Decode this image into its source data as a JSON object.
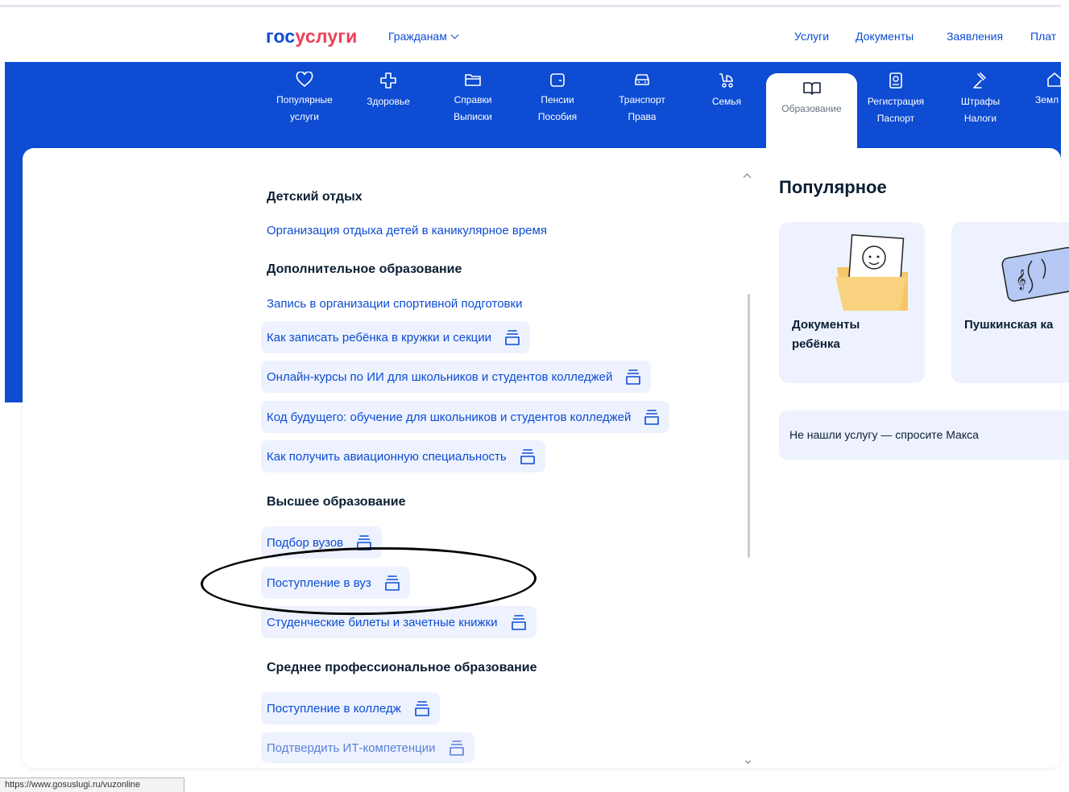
{
  "header": {
    "logo_part1": "гос",
    "logo_part2": "услуги",
    "citizens": "Гражданам",
    "nav": [
      "Услуги",
      "Документы",
      "Заявления",
      "Плат"
    ]
  },
  "categories": [
    {
      "line1": "Популярные",
      "line2": "услуги",
      "icon": "heart-icon"
    },
    {
      "line1": "Здоровье",
      "line2": "",
      "icon": "medical-cross-icon"
    },
    {
      "line1": "Справки",
      "line2": "Выписки",
      "icon": "folder-icon"
    },
    {
      "line1": "Пенсии",
      "line2": "Пособия",
      "icon": "wallet-icon"
    },
    {
      "line1": "Транспорт",
      "line2": "Права",
      "icon": "car-icon"
    },
    {
      "line1": "Семья",
      "line2": "",
      "icon": "stroller-icon"
    },
    {
      "line1": "Образование",
      "line2": "",
      "icon": "book-icon",
      "active": true
    },
    {
      "line1": "Регистрация",
      "line2": "Паспорт",
      "icon": "passport-icon"
    },
    {
      "line1": "Штрафы",
      "line2": "Налоги",
      "icon": "gavel-icon"
    },
    {
      "line1": "Земл",
      "line2": "",
      "icon": "house-icon"
    }
  ],
  "sections": {
    "kids_rest": {
      "title": "Детский отдых",
      "links": [
        "Организация отдыха детей в каникулярное время"
      ]
    },
    "additional": {
      "title": "Дополнительное образование",
      "links": [
        "Запись в организации спортивной подготовки",
        "Как записать ребёнка в кружки и секции",
        "Онлайн-курсы по ИИ для школьников и студентов колледжей",
        "Код будущего: обучение для школьников и студентов колледжей",
        "Как получить авиационную специальность"
      ]
    },
    "higher": {
      "title": "Высшее образование",
      "links": [
        "Подбор вузов",
        "Поступление в вуз",
        "Студенческие билеты и зачетные книжки"
      ]
    },
    "secondary": {
      "title": "Среднее профессиональное образование",
      "links": [
        "Поступление в колледж",
        "Подтвердить ИТ-компетенции"
      ]
    }
  },
  "popular": {
    "title": "Популярное",
    "cards": [
      {
        "line1": "Документы",
        "line2": "ребёнка"
      },
      {
        "line1": "Пушкинская ка",
        "line2": ""
      }
    ],
    "ask": "Не нашли услугу — спросите Макса"
  },
  "status_url": "https://www.gosuslugi.ru/vuzonline",
  "colors": {
    "brand_blue": "#0d4cd3",
    "brand_red": "#ee3f58",
    "pill_bg": "#edf2fe"
  }
}
